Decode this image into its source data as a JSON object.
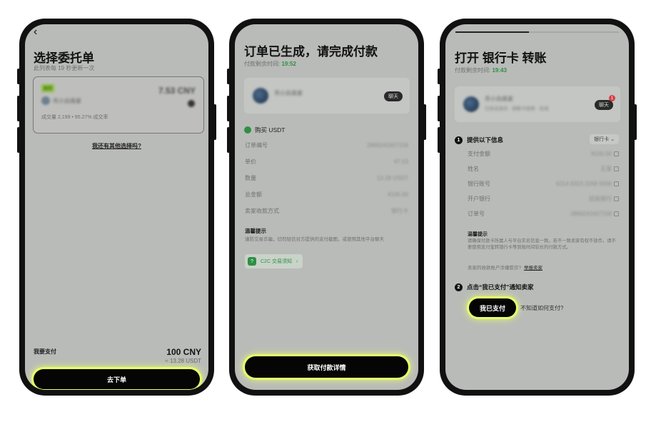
{
  "screen1": {
    "back_glyph": "‹",
    "title": "选择委托单",
    "subtitle": "此列表每 19 秒更新一次",
    "seller_badge": "推荐",
    "seller_name": "币小白商家",
    "price": "7.53 CNY",
    "stats": "成交量 2,199 • 95.27% 成交率",
    "other_link": "我还有其他选择吗?",
    "pay_label": "我要支付",
    "pay_amount": "100 CNY",
    "pay_usdt": "≈ 13.28 USDT",
    "order_button": "去下单"
  },
  "screen2": {
    "title": "订单已生成，请完成付款",
    "countdown_label": "付款剩余时间:",
    "countdown_value": "19:52",
    "seller_name": "币小白商家",
    "chat_button": "聊天",
    "buy_label": "购买 USDT",
    "rows": [
      {
        "label": "订单编号",
        "value": "2869241607156"
      },
      {
        "label": "单价",
        "value": "¥7.53"
      },
      {
        "label": "数量",
        "value": "13.28 USDT"
      },
      {
        "label": "总金额",
        "value": "¥100.00"
      },
      {
        "label": "卖家收款方式",
        "value": "银行卡"
      }
    ],
    "tip_title": "温馨提示",
    "tip_text": "谨防交易诈骗，切勿轻信对方提供的支付截图，或使用其他平台聊天",
    "guide_link": "C2C 交易须知",
    "action_button": "获取付款详情"
  },
  "screen3": {
    "title": "打开 银行卡 转账",
    "countdown_label": "付款剩余时间:",
    "countdown_value": "19:43",
    "seller_name": "币小白商家",
    "seller_detail": "已验证身份 · 银联卡收款 · 在线",
    "chat_button": "聊天",
    "chat_badge": "1",
    "step1_title": "提供以下信息",
    "method_select": "银行卡",
    "rows": [
      {
        "label": "支付金额",
        "value": "¥100.00"
      },
      {
        "label": "姓名",
        "value": "王某"
      },
      {
        "label": "银行账号",
        "value": "6214 8323 2268 5556"
      },
      {
        "label": "开户银行",
        "value": "招商银行"
      },
      {
        "label": "订单号",
        "value": "2869241607156"
      }
    ],
    "tip_title": "温馨提示",
    "tip_text": "请确保付款卡所属人与平台实名信息一致。若不一致卖家有权不放币。请不要使用支付宝转银行卡等到账时间较长的付款方式。",
    "report_prefix": "卖家的收款账户涉嫌欺诈?",
    "report_link": "举报卖家",
    "step2_title": "点击“我已支付”通知卖家",
    "paid_button": "我已支付",
    "help_link": "不知道如何支付?"
  }
}
